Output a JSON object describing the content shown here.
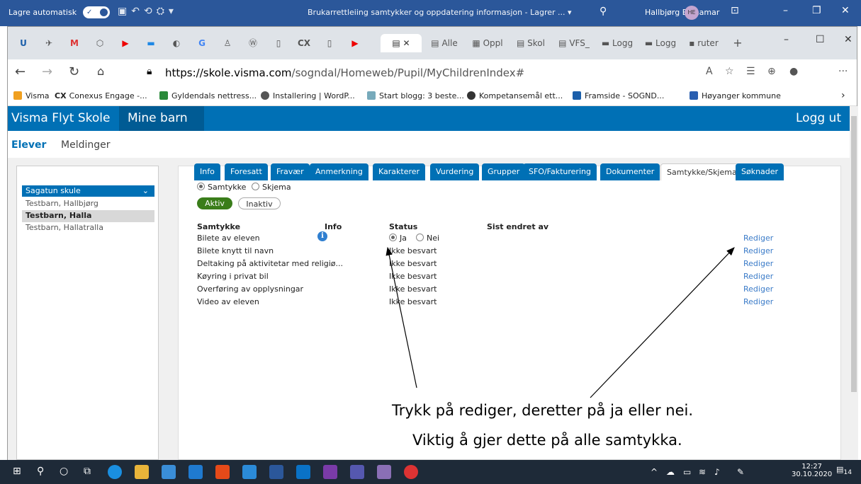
{
  "word": {
    "autosave": "Lagre automatisk",
    "toggle": "På",
    "doc_title": "Brukarrettleiing samtykker og oppdatering informasjon - Lagrer ... ▾",
    "user": "Hallbjørg Eidhamar",
    "initials": "HE"
  },
  "browser": {
    "tabs": [
      "Alle",
      "Oppl",
      "Skol",
      "VFS_",
      "Logg",
      "Logg",
      "ruter"
    ],
    "url_host": "https://skole.visma.com",
    "url_path": "/sogndal/Homeweb/Pupil/MyChildrenIndex#",
    "bookmarks": [
      "Visma",
      "Conexus Engage -...",
      "Gyldendals nettress...",
      "Installering | WordP...",
      "Start blogg: 3 beste...",
      "Kompetansemål ett...",
      "Framside - SOGND...",
      "Høyanger kommune"
    ]
  },
  "app": {
    "brand": "Visma Flyt Skole",
    "mine": "Mine barn",
    "logout": "Logg ut",
    "nav_elever": "Elever",
    "nav_meldinger": "Meldinger",
    "school": "Sagatun skule",
    "children": [
      "Testbarn, Hallbjørg",
      "Testbarn, Halla",
      "Testbarn, Hallatralla"
    ],
    "tabs": [
      "Info",
      "Foresatt",
      "Fravær",
      "Anmerkning",
      "Karakterer",
      "Vurdering",
      "Grupper",
      "SFO/Fakturering",
      "Dokumenter",
      "Samtykke/Skjema",
      "Søknader"
    ],
    "radio_samtykke": "Samtykke",
    "radio_skjema": "Skjema",
    "btn_aktiv": "Aktiv",
    "btn_inaktiv": "Inaktiv",
    "col_samtykke": "Samtykke",
    "col_info": "Info",
    "col_status": "Status",
    "col_sist": "Sist endret av",
    "rows": [
      {
        "name": "Bilete av eleven",
        "status": ""
      },
      {
        "name": "Bilete knytt til navn",
        "status": "Ikke besvart"
      },
      {
        "name": "Deltaking på aktivitetar med religiø...",
        "status": "Ikke besvart"
      },
      {
        "name": "Køyring i privat bil",
        "status": "Ikke besvart"
      },
      {
        "name": "Overføring av opplysningar",
        "status": "Ikke besvart"
      },
      {
        "name": "Video av eleven",
        "status": "Ikke besvart"
      }
    ],
    "ja": "Ja",
    "nei": "Nei",
    "rediger": "Rediger"
  },
  "annotation": {
    "line1": "Trykk på rediger, deretter på ja eller nei.",
    "line2": "Viktig å gjer dette på alle samtykka."
  },
  "clock": {
    "time": "12:27",
    "date": "30.10.2020",
    "notif": "14"
  }
}
